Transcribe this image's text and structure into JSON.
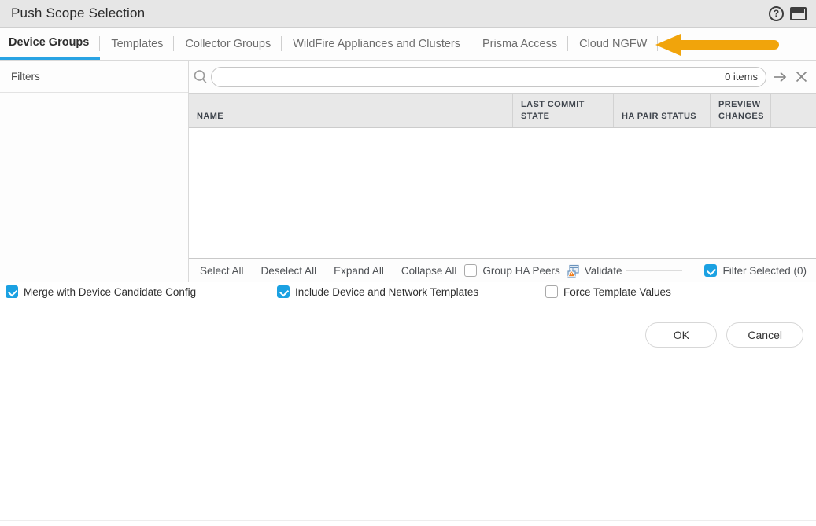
{
  "dialog": {
    "title": "Push Scope Selection"
  },
  "header_icons": {
    "help_glyph": "?",
    "help": "help-icon",
    "window": "window-panel-icon"
  },
  "tabs": [
    {
      "label": "Device Groups",
      "active": true
    },
    {
      "label": "Templates",
      "active": false
    },
    {
      "label": "Collector Groups",
      "active": false
    },
    {
      "label": "WildFire Appliances and Clusters",
      "active": false
    },
    {
      "label": "Prisma Access",
      "active": false
    },
    {
      "label": "Cloud NGFW",
      "active": false
    }
  ],
  "annotation": {
    "arrow": "orange-arrow-pointing-at-cloud-ngfw-tab",
    "arrow_color": "#f1a40b"
  },
  "sidebar": {
    "title": "Filters"
  },
  "search": {
    "value": "",
    "items_count": "0 items",
    "icons": [
      "search-icon",
      "apply-arrow-icon",
      "clear-x-icon"
    ]
  },
  "table": {
    "columns": [
      "NAME",
      "LAST COMMIT STATE",
      "HA PAIR STATUS",
      "PREVIEW CHANGES"
    ],
    "rows": []
  },
  "toolbar": {
    "select_all": "Select All",
    "deselect_all": "Deselect All",
    "expand_all": "Expand All",
    "collapse_all": "Collapse All",
    "group_ha_peers": {
      "label": "Group HA Peers",
      "checked": false
    },
    "validate_label": "Validate",
    "validate_icon": "validate-document-warning-icon",
    "filter_selected": {
      "label": "Filter Selected (0)",
      "checked": true
    }
  },
  "options": [
    {
      "label": "Merge with Device Candidate Config",
      "checked": true
    },
    {
      "label": "Include Device and Network Templates",
      "checked": true
    },
    {
      "label": "Force Template Values",
      "checked": false
    }
  ],
  "footer": {
    "ok_label": "OK",
    "cancel_label": "Cancel"
  },
  "colors": {
    "accent_blue": "#29a3e3",
    "checkbox_blue": "#1ba1e2",
    "arrow_orange": "#f1a40b",
    "titlebar_gray": "#e6e6e6",
    "table_header_gray": "#e8e8e8"
  }
}
